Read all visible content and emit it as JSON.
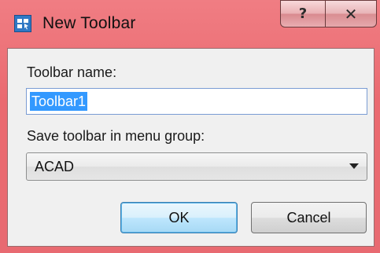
{
  "window": {
    "title": "New Toolbar",
    "help_glyph": "?",
    "close_glyph": "✕",
    "icon": "toolbar-app-icon"
  },
  "form": {
    "name_label": "Toolbar name:",
    "name_value": "Toolbar1",
    "group_label": "Save toolbar in menu group:",
    "group_value": "ACAD"
  },
  "buttons": {
    "ok": "OK",
    "cancel": "Cancel"
  },
  "colors": {
    "title_bar": "#ea6a70",
    "selection": "#3399ff",
    "default_button_border": "#3c7fb1"
  }
}
